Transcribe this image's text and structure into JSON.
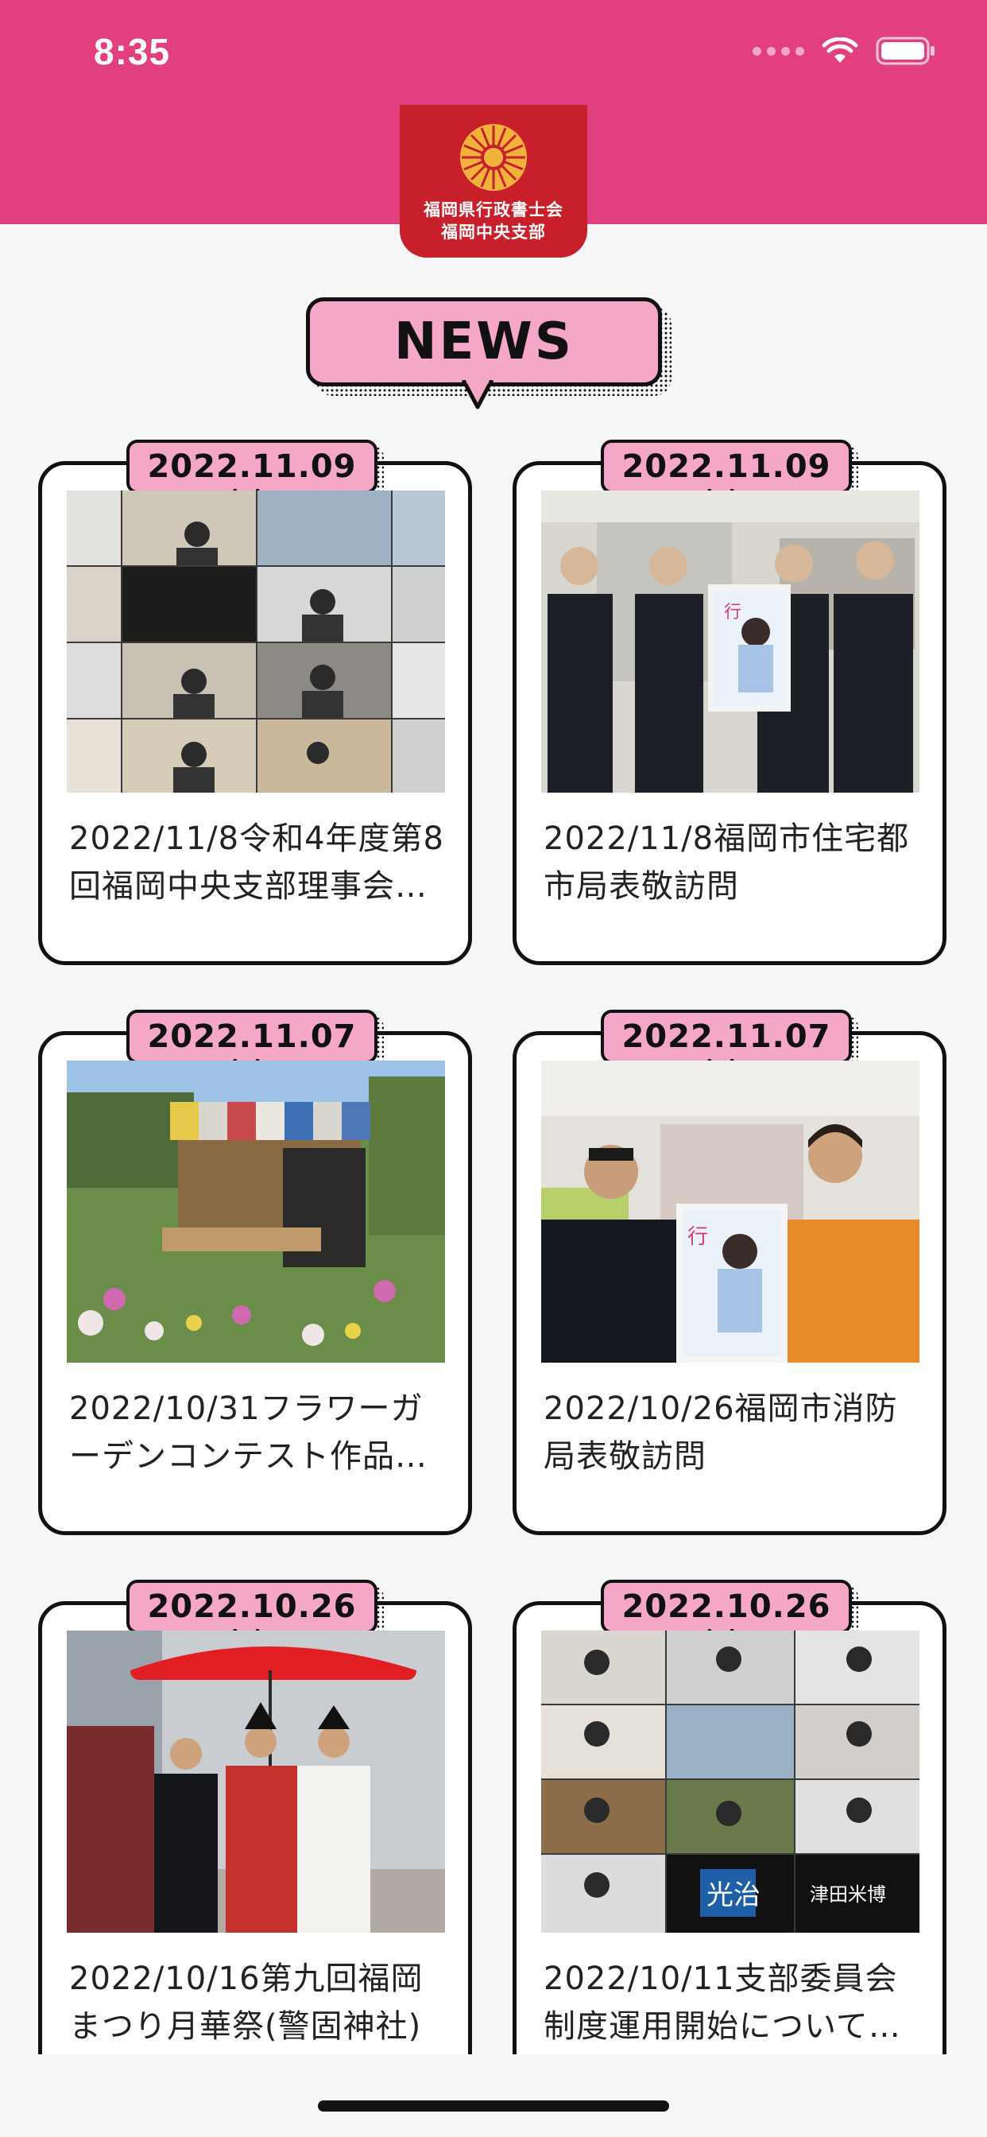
{
  "status_bar": {
    "time": "8:35"
  },
  "brand": {
    "line1": "福岡県行政書士会",
    "line2": "福岡中央支部",
    "logo_glyph": "chrysanthemum-emblem"
  },
  "section": {
    "heading": "NEWS"
  },
  "news": [
    {
      "date": "2022.11.09",
      "title": "2022/11/8令和4年度第8回福岡中央支部理事会…",
      "photo": "video-conference-grid"
    },
    {
      "date": "2022.11.09",
      "title": "2022/11/8福岡市住宅都市局表敬訪問",
      "photo": "office-group-poster"
    },
    {
      "date": "2022.11.07",
      "title": "2022/10/31フラワーガーデンコンテスト作品展…",
      "photo": "flower-garden"
    },
    {
      "date": "2022.11.07",
      "title": "2022/10/26福岡市消防局表敬訪問",
      "photo": "fire-bureau-poster"
    },
    {
      "date": "2022.10.26",
      "title": "2022/10/16第九回福岡まつり月華祭(警固神社)",
      "photo": "festival-umbrella"
    },
    {
      "date": "2022.10.26",
      "title": "2022/10/11支部委員会制度運用開始についての…",
      "photo": "video-conference-grid-2"
    }
  ],
  "colors": {
    "header": "#e23f7e",
    "tag": "#f4a7c6",
    "logo": "#c8202b"
  }
}
